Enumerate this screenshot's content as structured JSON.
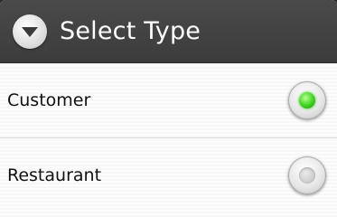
{
  "dialog": {
    "title": "Select Type",
    "title_icon": "chevron-down-circle-icon"
  },
  "options": [
    {
      "label": "Customer",
      "selected": true
    },
    {
      "label": "Restaurant",
      "selected": false
    }
  ],
  "colors": {
    "titlebar": "#404040",
    "selected_dot": "#3fd01f"
  }
}
